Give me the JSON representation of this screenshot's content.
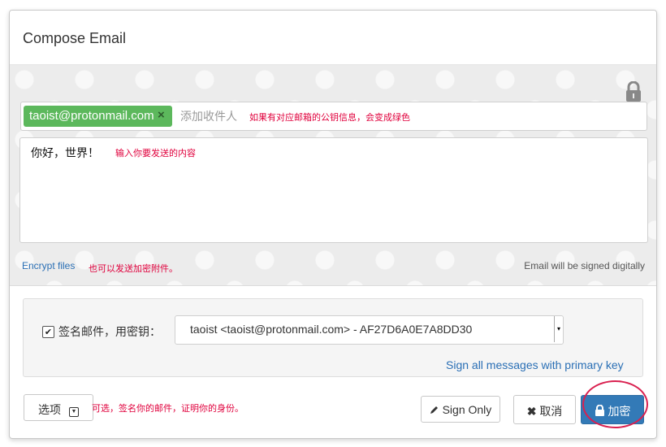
{
  "dialog": {
    "title": "Compose Email"
  },
  "recipients": {
    "tag": "taoist@protonmail.com",
    "remove_symbol": "×",
    "placeholder": "添加收件人",
    "annotation": "如果有对应邮箱的公钥信息，会变成绿色"
  },
  "message": {
    "body": "你好，世界！",
    "annotation": "输入你要发送的内容"
  },
  "attachments": {
    "encrypt_files_label": "Encrypt files",
    "annotation": "也可以发送加密附件。",
    "signed_note": "Email will be signed digitally"
  },
  "signing": {
    "checked": true,
    "check_symbol": "✔",
    "label": "签名邮件，用密钥：",
    "selected_key": "taoist <taoist@protonmail.com> - AF27D6A0E7A8DD30",
    "primary_key_link": "Sign all messages with primary key"
  },
  "footer": {
    "options_label": "选项",
    "options_annotation": "可选，签名你的邮件，证明你的身份。",
    "sign_only_label": "Sign Only",
    "cancel_label": "取消",
    "encrypt_label": "加密"
  },
  "colors": {
    "recipient_tag": "#5cb85c",
    "primary_button": "#337ab7",
    "annotation_red": "#e0003c",
    "link_blue": "#2a6fb5"
  },
  "icons": [
    "lock-icon",
    "close-icon",
    "checkbox-icon",
    "chevron-down-icon",
    "pencil-icon",
    "x-icon",
    "lock-icon"
  ]
}
